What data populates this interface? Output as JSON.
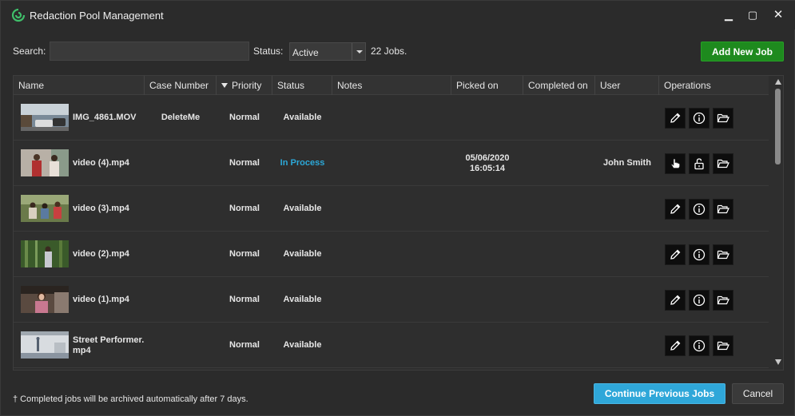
{
  "window": {
    "title": "Redaction Pool Management",
    "controls": {
      "minimize": "▁",
      "maximize": "▢",
      "close": "✕"
    }
  },
  "toolbar": {
    "search_label": "Search:",
    "search_value": "",
    "status_label": "Status:",
    "status_value": "Active",
    "job_count": "22 Jobs.",
    "add_job_label": "Add New Job"
  },
  "table": {
    "columns": [
      "Name",
      "Case Number",
      "Priority",
      "Status",
      "Notes",
      "Picked on",
      "Completed on",
      "User",
      "Operations"
    ],
    "sorted_column": "Priority",
    "rows": [
      {
        "name": "IMG_4861.MOV",
        "case_number": "DeleteMe",
        "priority": "Normal",
        "status": "Available",
        "notes": "",
        "picked_on": "",
        "completed_on": "",
        "user": "",
        "ops": [
          "edit-icon",
          "info-icon",
          "folder-open-icon"
        ]
      },
      {
        "name": "video (4).mp4",
        "case_number": "",
        "priority": "Normal",
        "status": "In Process",
        "notes": "",
        "picked_on": "05/06/2020 16:05:14",
        "completed_on": "",
        "user": "John Smith",
        "ops": [
          "hand-cursor-icon",
          "unlock-icon",
          "folder-open-icon"
        ]
      },
      {
        "name": "video (3).mp4",
        "case_number": "",
        "priority": "Normal",
        "status": "Available",
        "notes": "",
        "picked_on": "",
        "completed_on": "",
        "user": "",
        "ops": [
          "edit-icon",
          "info-icon",
          "folder-open-icon"
        ]
      },
      {
        "name": "video (2).mp4",
        "case_number": "",
        "priority": "Normal",
        "status": "Available",
        "notes": "",
        "picked_on": "",
        "completed_on": "",
        "user": "",
        "ops": [
          "edit-icon",
          "info-icon",
          "folder-open-icon"
        ]
      },
      {
        "name": "video (1).mp4",
        "case_number": "",
        "priority": "Normal",
        "status": "Available",
        "notes": "",
        "picked_on": "",
        "completed_on": "",
        "user": "",
        "ops": [
          "edit-icon",
          "info-icon",
          "folder-open-icon"
        ]
      },
      {
        "name": "Street Performer.mp4",
        "case_number": "",
        "priority": "Normal",
        "status": "Available",
        "notes": "",
        "picked_on": "",
        "completed_on": "",
        "user": "",
        "ops": [
          "edit-icon",
          "info-icon",
          "folder-open-icon"
        ]
      }
    ]
  },
  "footer": {
    "note": "† Completed jobs will be archived automatically after 7 days.",
    "continue_label": "Continue Previous Jobs",
    "cancel_label": "Cancel"
  },
  "colors": {
    "add_button": "#1e8a1e",
    "continue_button": "#2fa7d9",
    "in_process": "#2ca8d8",
    "background": "#2b2b2b"
  }
}
